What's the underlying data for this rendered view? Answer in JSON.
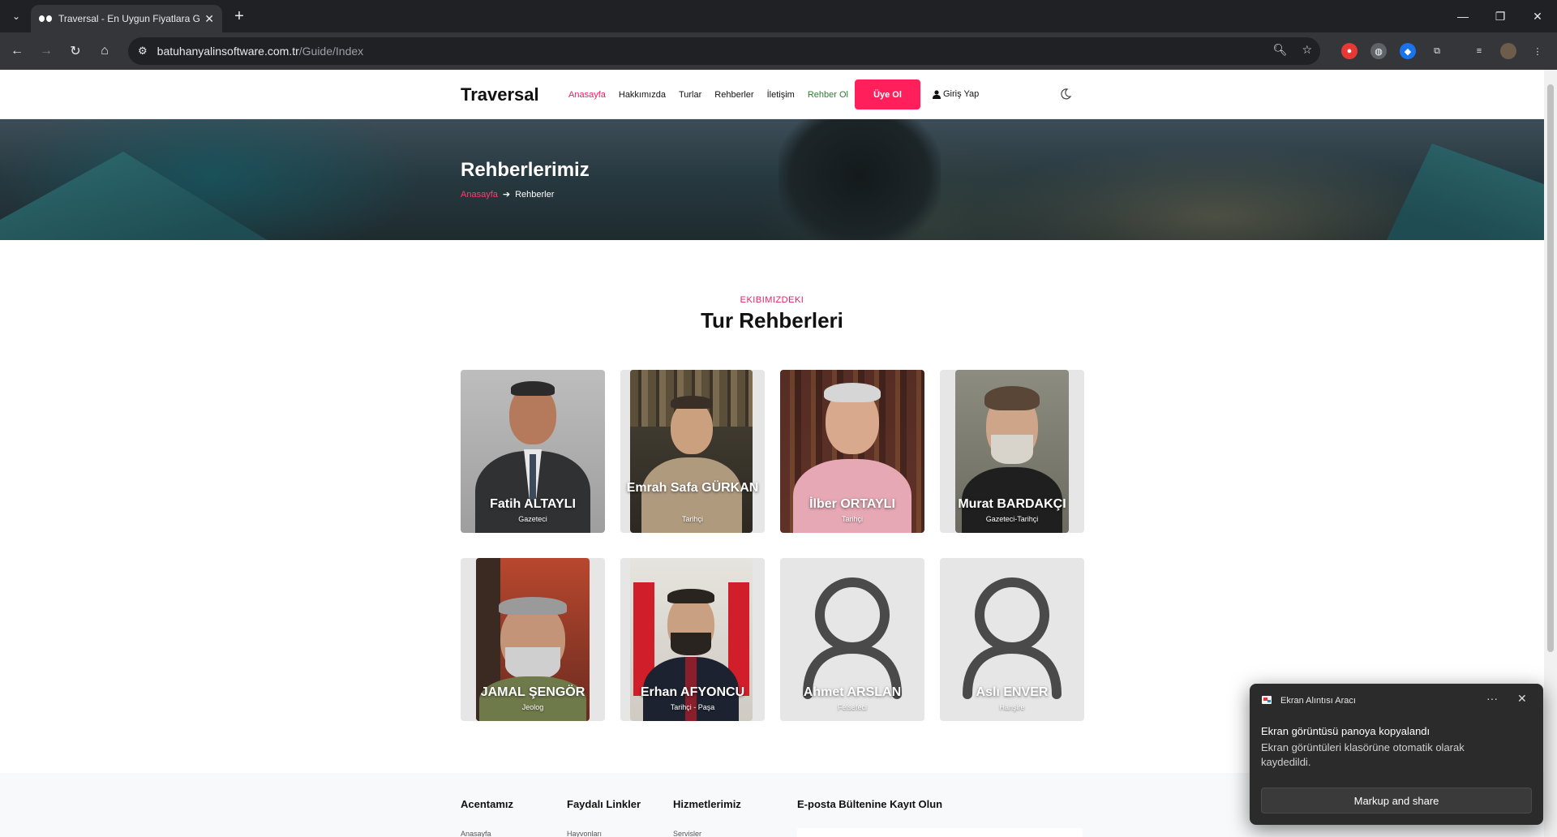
{
  "browser": {
    "tab_title": "Traversal - En Uygun Fiyatlara G",
    "tab_close": "✕",
    "new_tab": "+",
    "url_domain": "batuhanyalinsoftware.com.tr",
    "url_path": "/Guide/Index",
    "window_controls": [
      "—",
      "❐",
      "✕"
    ]
  },
  "header": {
    "logo": "Traversal",
    "nav": [
      {
        "label": "Anasayfa",
        "state": "active"
      },
      {
        "label": "Hakkımızda",
        "state": "normal"
      },
      {
        "label": "Turlar",
        "state": "normal"
      },
      {
        "label": "Rehberler",
        "state": "normal"
      },
      {
        "label": "İletişim",
        "state": "normal"
      },
      {
        "label": "Rehber Ol",
        "state": "green"
      }
    ],
    "signup_label": "Üye Ol",
    "login_label": "Giriş Yap",
    "colors": {
      "accent": "#ff1f5a",
      "active_link": "#e91e63",
      "green_link": "#2e7d32"
    }
  },
  "hero": {
    "title": "Rehberlerimiz",
    "breadcrumb_home": "Anasayfa",
    "breadcrumb_sep": "➔",
    "breadcrumb_current": "Rehberler"
  },
  "section": {
    "eyebrow": "EKIBIMIZDEKI",
    "title": "Tur Rehberleri"
  },
  "guides": [
    {
      "name": "Fatih ALTAYLI",
      "role": "Gazeteci",
      "has_photo": true
    },
    {
      "name": "Emrah Safa GÜRKAN",
      "role": "Tarihçi",
      "has_photo": true
    },
    {
      "name": "İlber ORTAYLI",
      "role": "Tarihçi",
      "has_photo": true
    },
    {
      "name": "Murat BARDAKÇI",
      "role": "Gazeteci-Tarihçi",
      "has_photo": true
    },
    {
      "name": "JAMAL ŞENGÖR",
      "role": "Jeolog",
      "has_photo": true
    },
    {
      "name": "Erhan AFYONCU",
      "role": "Tarihçi - Paşa",
      "has_photo": true
    },
    {
      "name": "Ahmet ARSLAN",
      "role": "Felsefeci",
      "has_photo": false
    },
    {
      "name": "Aslı ENVER",
      "role": "Hanşire",
      "has_photo": false
    }
  ],
  "footer": {
    "col1_title": "Acentamız",
    "col1_link": "Anasayfa",
    "col2_title": "Faydalı Linkler",
    "col2_link": "Hayvonları",
    "col3_title": "Hizmetlerimiz",
    "col3_link": "Servisler",
    "col4_title": "E-posta Bültenine Kayıt Olun"
  },
  "toast": {
    "app_name": "Ekran Alıntısı Aracı",
    "more": "···",
    "close": "✕",
    "title": "Ekran görüntüsü panoya kopyalandı",
    "message": "Ekran görüntüleri klasörüne otomatik olarak kaydedildi.",
    "button": "Markup and share"
  }
}
